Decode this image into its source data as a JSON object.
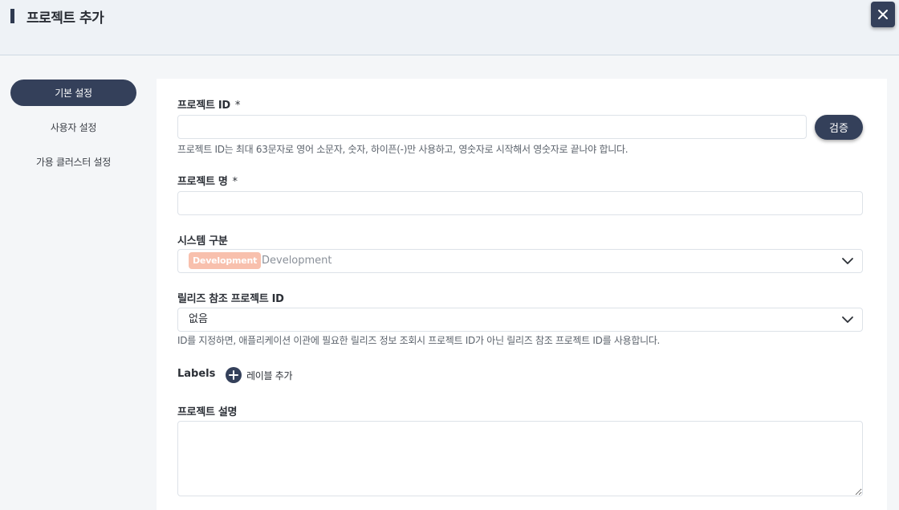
{
  "header": {
    "title": "프로젝트 추가",
    "close_icon": "close-icon"
  },
  "sidebar": {
    "items": [
      {
        "label": "기본 설정",
        "active": true
      },
      {
        "label": "사용자 설정",
        "active": false
      },
      {
        "label": "가용 클러스터 설정",
        "active": false
      }
    ]
  },
  "form": {
    "project_id": {
      "label": "프로젝트 ID",
      "required_mark": "*",
      "value": "",
      "placeholder": "",
      "verify_label": "검증",
      "help": "프로젝트 ID는 최대 63문자로 영어 소문자, 숫자, 하이픈(-)만 사용하고, 영숫자로 시작해서 영숫자로 끝나야 합니다."
    },
    "project_name": {
      "label": "프로젝트 명",
      "required_mark": "*",
      "value": "",
      "placeholder": ""
    },
    "system_type": {
      "label": "시스템 구분",
      "tag": "Development",
      "selected": "Development",
      "tag_color": "#f8c0ad"
    },
    "release_ref": {
      "label": "릴리즈 참조 프로젝트 ID",
      "selected": "없음",
      "help": "ID를 지정하면, 애플리케이션 이관에 필요한 릴리즈 정보 조회시 프로젝트 ID가 아닌 릴리즈 참조 프로젝트 ID를 사용합니다."
    },
    "labels": {
      "title": "Labels",
      "add_label": "레이블 추가"
    },
    "description": {
      "label": "프로젝트 설명",
      "value": ""
    }
  },
  "colors": {
    "primary": "#34405a",
    "header_bg": "#eef2f6",
    "page_bg": "#f4f6f8"
  }
}
